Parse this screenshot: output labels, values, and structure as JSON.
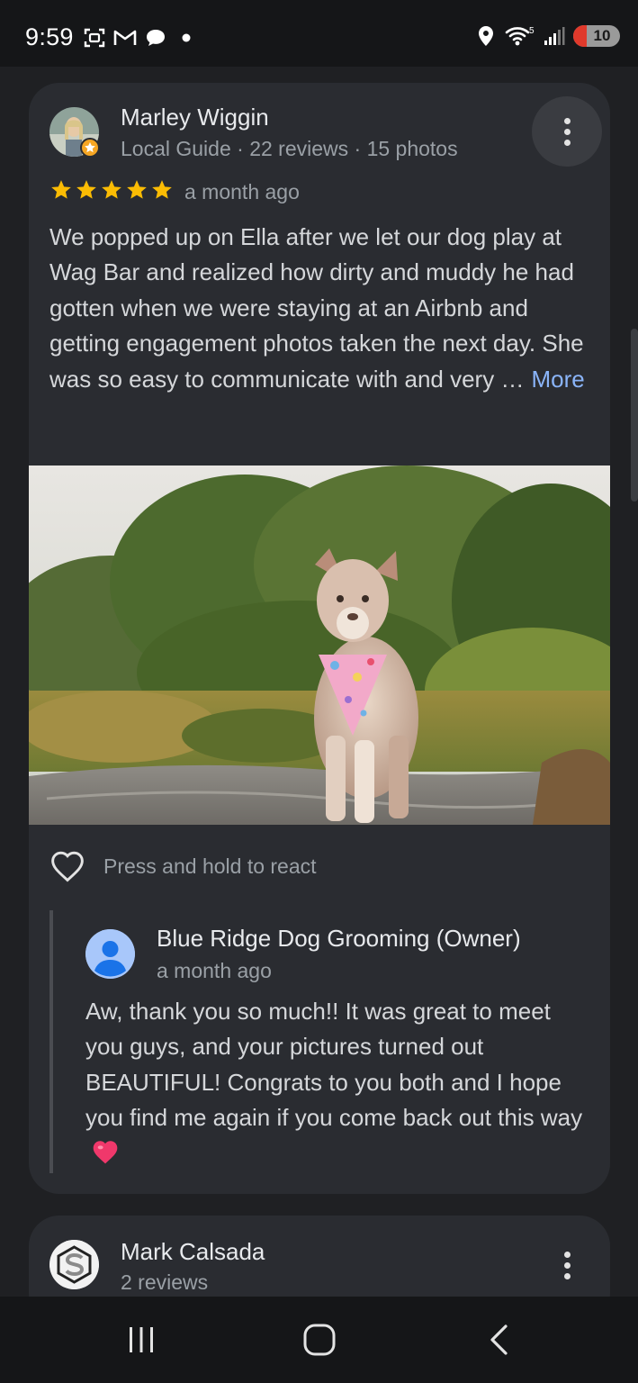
{
  "status_bar": {
    "time": "9:59",
    "network": "5",
    "battery": "10"
  },
  "review1": {
    "name": "Marley Wiggin",
    "subtitle": "Local Guide · 22 reviews · 15 photos",
    "rating": 5,
    "time_ago": "a month ago",
    "text": "We popped up on Ella after we let our dog play at Wag Bar and realized how dirty and muddy he had gotten when we were staying at an Airbnb and getting engagement photos taken the next day. She was so easy to communicate with and very …",
    "more_label": "More",
    "react_label": "Press and hold to react"
  },
  "owner_reply": {
    "name": "Blue Ridge Dog Grooming (Owner)",
    "time_ago": "a month ago",
    "text": "Aw, thank you so much!! It was great to meet you guys, and your pictures turned out BEAUTIFUL! Congrats to you both and I hope you find me again if you come back out this way"
  },
  "review2": {
    "name": "Mark Calsada",
    "subtitle": "2 reviews"
  },
  "colors": {
    "background": "#1f2023",
    "card": "#2a2c31",
    "star": "#fbbc04",
    "link": "#8ab4f8"
  }
}
